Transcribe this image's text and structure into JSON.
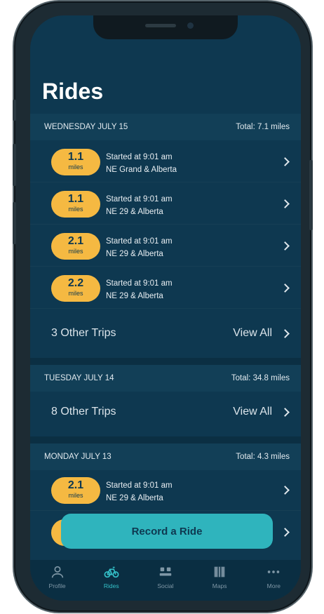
{
  "page": {
    "title": "Rides"
  },
  "sections": [
    {
      "date": "WEDNESDAY JULY 15",
      "total": "Total: 7.1 miles",
      "rides": [
        {
          "distance": "1.1",
          "unit": "miles",
          "started": "Started at 9:01 am",
          "location": "NE Grand & Alberta"
        },
        {
          "distance": "1.1",
          "unit": "miles",
          "started": "Started at 9:01 am",
          "location": "NE 29 & Alberta"
        },
        {
          "distance": "2.1",
          "unit": "miles",
          "started": "Started at 9:01 am",
          "location": "NE 29 & Alberta"
        },
        {
          "distance": "2.2",
          "unit": "miles",
          "started": "Started at 9:01 am",
          "location": "NE 29 & Alberta"
        }
      ],
      "other_trips": "3 Other Trips",
      "view_all": "View All"
    },
    {
      "date": "TUESDAY JULY 14",
      "total": "Total: 34.8 miles",
      "other_trips": "8 Other Trips",
      "view_all": "View All"
    },
    {
      "date": "MONDAY JULY 13",
      "total": "Total: 4.3 miles",
      "rides": [
        {
          "distance": "2.1",
          "unit": "miles",
          "started": "Started at 9:01 am",
          "location": "NE 29 & Alberta"
        }
      ]
    }
  ],
  "record_button": "Record a Ride",
  "tabs": [
    {
      "label": "Profile",
      "icon": "person-icon",
      "active": false
    },
    {
      "label": "Rides",
      "icon": "bicycle-icon",
      "active": true
    },
    {
      "label": "Social",
      "icon": "people-icon",
      "active": false
    },
    {
      "label": "Maps",
      "icon": "map-icon",
      "active": false
    },
    {
      "label": "More",
      "icon": "more-icon",
      "active": false
    }
  ],
  "colors": {
    "background": "#0e3850",
    "section_header": "#123f57",
    "pill": "#f5b942",
    "accent": "#2fb4bd",
    "tab_active": "#34c1c9"
  }
}
